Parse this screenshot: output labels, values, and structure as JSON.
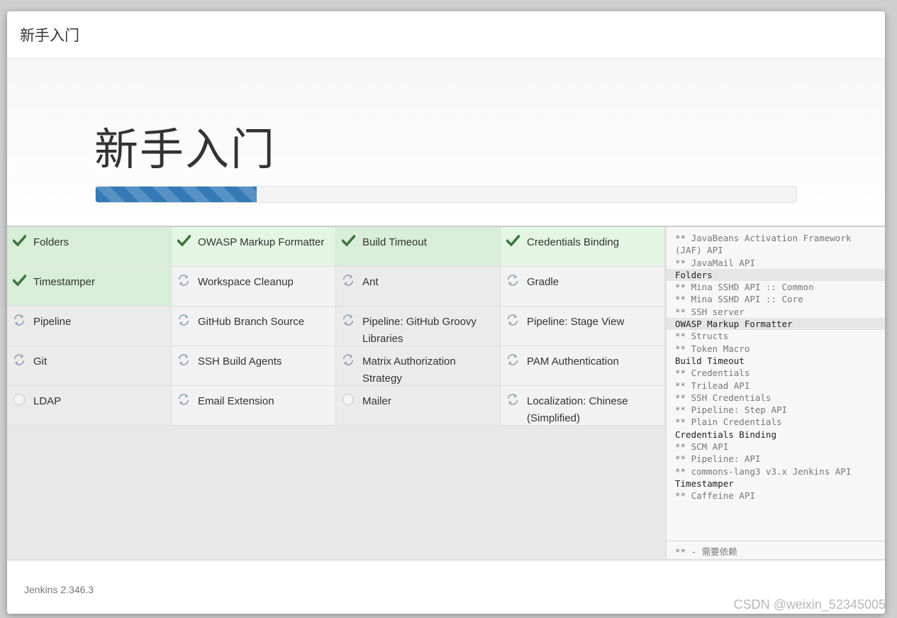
{
  "header": {
    "title": "新手入门"
  },
  "hero": {
    "title": "新手入门",
    "progress": 0.23
  },
  "plugins": [
    {
      "name": "Folders",
      "status": "success",
      "icon": "check-icon",
      "bg": "success"
    },
    {
      "name": "OWASP Markup Formatter",
      "status": "success",
      "icon": "check-icon",
      "bg": "success light"
    },
    {
      "name": "Build Timeout",
      "status": "success",
      "icon": "check-icon",
      "bg": "success"
    },
    {
      "name": "Credentials Binding",
      "status": "success",
      "icon": "check-icon",
      "bg": "success light"
    },
    {
      "name": "Timestamper",
      "status": "success",
      "icon": "check-icon",
      "bg": "success"
    },
    {
      "name": "Workspace Cleanup",
      "status": "installing",
      "icon": "spinner-icon",
      "bg": "pending"
    },
    {
      "name": "Ant",
      "status": "installing",
      "icon": "spinner-icon",
      "bg": "pending alt"
    },
    {
      "name": "Gradle",
      "status": "installing",
      "icon": "spinner-icon",
      "bg": "pending"
    },
    {
      "name": "Pipeline",
      "status": "installing",
      "icon": "spinner-icon",
      "bg": "pending alt"
    },
    {
      "name": "GitHub Branch Source",
      "status": "installing",
      "icon": "spinner-icon",
      "bg": "pending"
    },
    {
      "name": "Pipeline: GitHub Groovy Libraries",
      "status": "installing",
      "icon": "spinner-icon",
      "bg": "pending alt"
    },
    {
      "name": "Pipeline: Stage View",
      "status": "installing",
      "icon": "spinner-icon",
      "bg": "pending"
    },
    {
      "name": "Git",
      "status": "installing",
      "icon": "spinner-icon",
      "bg": "pending alt"
    },
    {
      "name": "SSH Build Agents",
      "status": "installing",
      "icon": "spinner-icon",
      "bg": "pending"
    },
    {
      "name": "Matrix Authorization Strategy",
      "status": "installing",
      "icon": "spinner-icon",
      "bg": "pending alt"
    },
    {
      "name": "PAM Authentication",
      "status": "installing",
      "icon": "spinner-icon",
      "bg": "pending"
    },
    {
      "name": "LDAP",
      "status": "pending",
      "icon": "circle-icon",
      "bg": "pending alt"
    },
    {
      "name": "Email Extension",
      "status": "installing",
      "icon": "spinner-icon",
      "bg": "pending"
    },
    {
      "name": "Mailer",
      "status": "pending",
      "icon": "circle-icon",
      "bg": "pending alt"
    },
    {
      "name": "Localization: Chinese (Simplified)",
      "status": "installing",
      "icon": "spinner-icon",
      "bg": "pending"
    }
  ],
  "log": {
    "lines": [
      {
        "text": "** JavaBeans Activation Framework (JAF) API",
        "type": "dep"
      },
      {
        "text": "** JavaMail API",
        "type": "dep"
      },
      {
        "text": "Folders",
        "type": "plugin",
        "hl": true
      },
      {
        "text": "** Mina SSHD API :: Common",
        "type": "dep"
      },
      {
        "text": "** Mina SSHD API :: Core",
        "type": "dep"
      },
      {
        "text": "** SSH server",
        "type": "dep"
      },
      {
        "text": "OWASP Markup Formatter",
        "type": "plugin",
        "hl": true
      },
      {
        "text": "** Structs",
        "type": "dep"
      },
      {
        "text": "** Token Macro",
        "type": "dep"
      },
      {
        "text": "Build Timeout",
        "type": "plugin"
      },
      {
        "text": "** Credentials",
        "type": "dep"
      },
      {
        "text": "** Trilead API",
        "type": "dep"
      },
      {
        "text": "** SSH Credentials",
        "type": "dep"
      },
      {
        "text": "** Pipeline: Step API",
        "type": "dep"
      },
      {
        "text": "** Plain Credentials",
        "type": "dep"
      },
      {
        "text": "Credentials Binding",
        "type": "plugin"
      },
      {
        "text": "** SCM API",
        "type": "dep"
      },
      {
        "text": "** Pipeline: API",
        "type": "dep"
      },
      {
        "text": "** commons-lang3 v3.x Jenkins API",
        "type": "dep"
      },
      {
        "text": "Timestamper",
        "type": "plugin"
      },
      {
        "text": "** Caffeine API",
        "type": "dep"
      }
    ],
    "footer": "** - 需要依赖"
  },
  "footer": {
    "version": "Jenkins 2.346.3"
  },
  "watermark": "CSDN @weixin_52345005",
  "colors": {
    "accent": "#337ab7",
    "success": "#3c763d"
  }
}
